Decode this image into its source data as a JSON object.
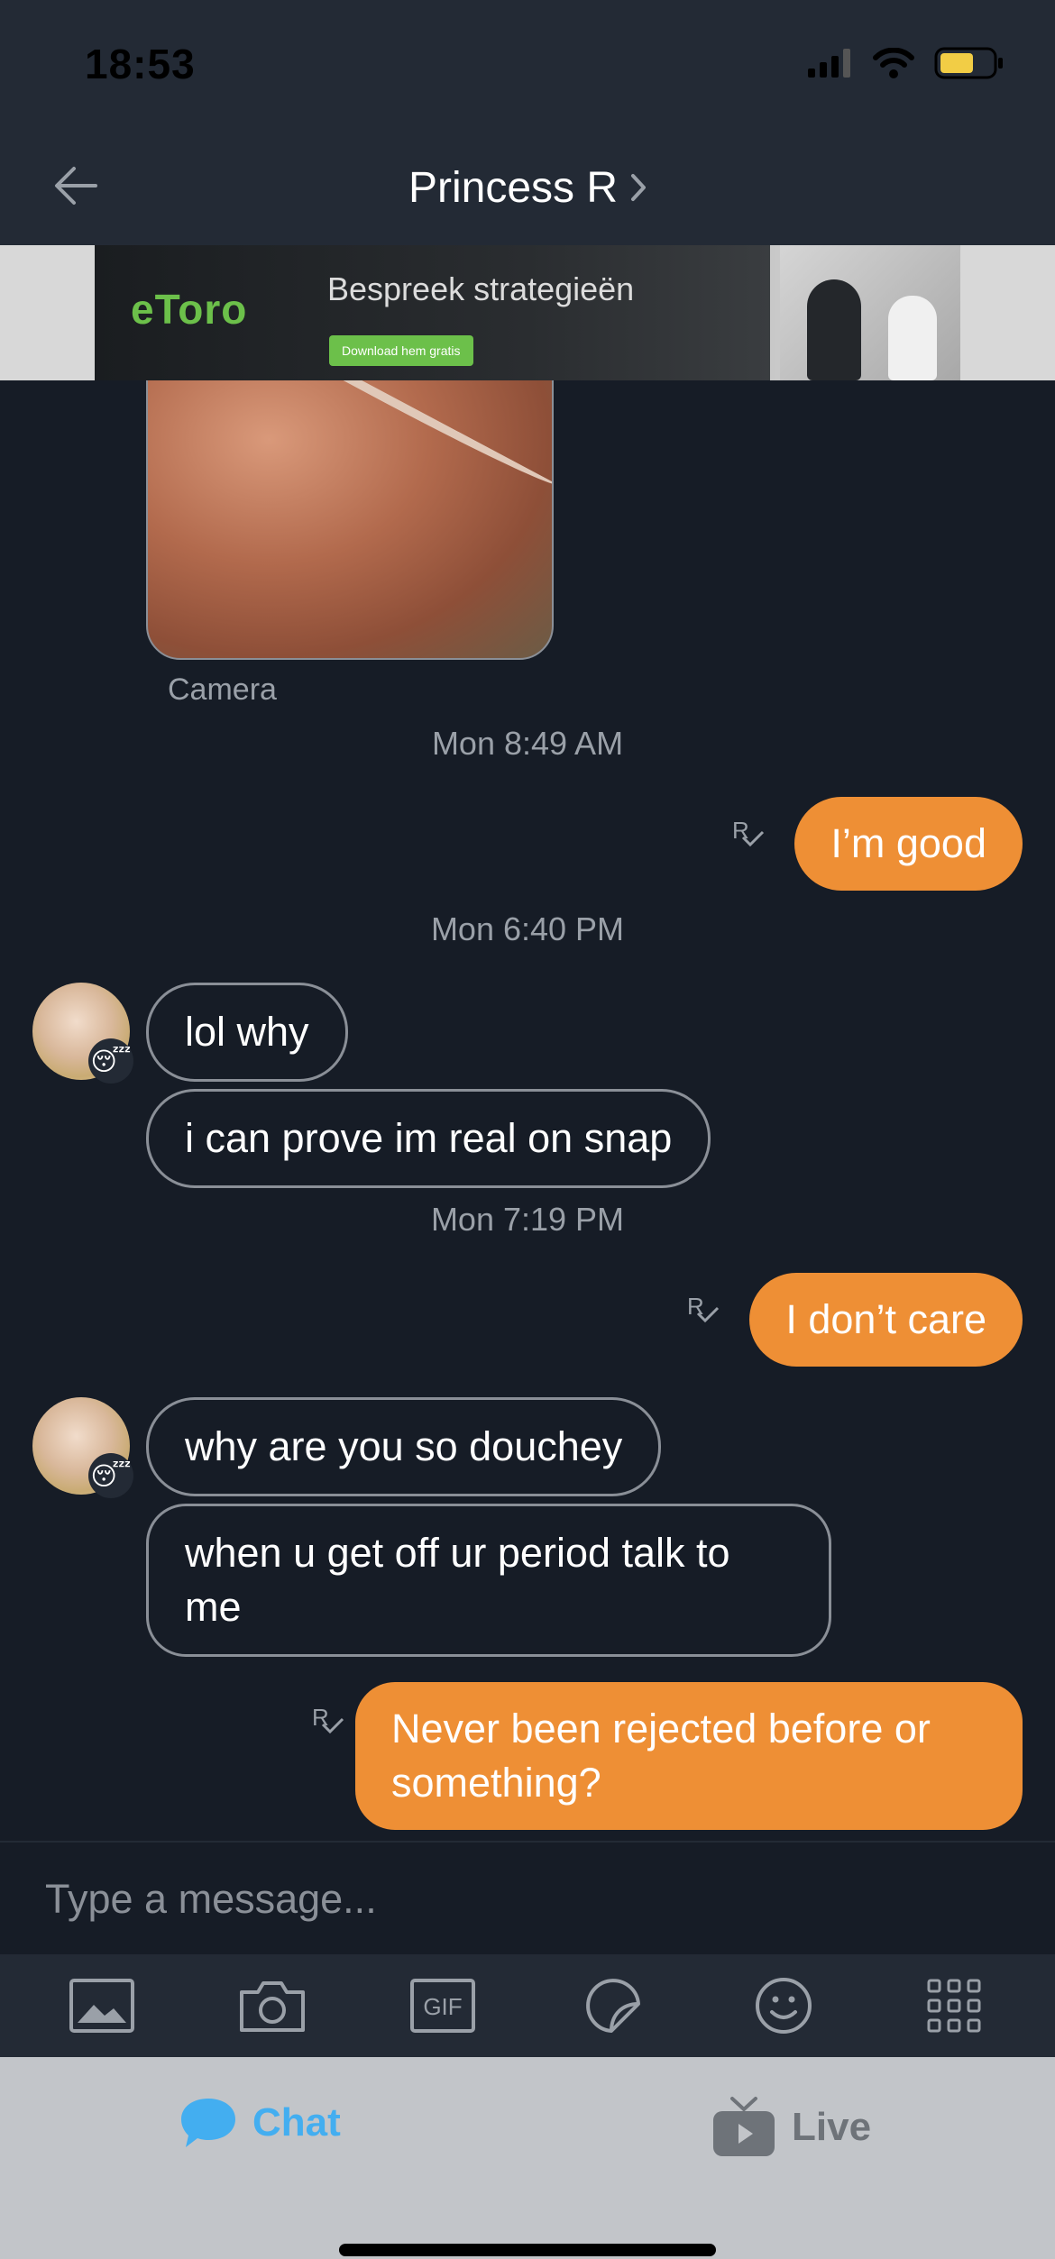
{
  "status": {
    "time": "18:53"
  },
  "header": {
    "title": "Princess R"
  },
  "ad": {
    "logo": "eToro",
    "headline": "Bespreek strategieën",
    "cta": "Download hem gratis"
  },
  "messages": {
    "photo_caption": "Camera",
    "ts1": "Mon 8:49 AM",
    "out1": "I’m good",
    "ts2": "Mon 6:40 PM",
    "in1": "lol why",
    "in2": "i can prove im real on snap",
    "ts3": "Mon 7:19 PM",
    "out2": "I don’t care",
    "in3": "why are you so douchey",
    "in4": "when u get off ur period talk to me",
    "out3": "Never been rejected before or something?",
    "receipt": "R"
  },
  "input": {
    "placeholder": "Type a message..."
  },
  "toolbar": {
    "gif_label": "GIF"
  },
  "tabs": {
    "chat": "Chat",
    "live": "Live"
  },
  "colors": {
    "accent": "#ee8f35",
    "chat_tab": "#43aef0",
    "background": "#161c26"
  },
  "icons": [
    "back-arrow-icon",
    "chevron-right-icon",
    "image-icon",
    "camera-icon",
    "gif-icon",
    "sticker-icon",
    "emoji-icon",
    "grid-icon",
    "chat-bubble-icon",
    "tv-icon"
  ]
}
